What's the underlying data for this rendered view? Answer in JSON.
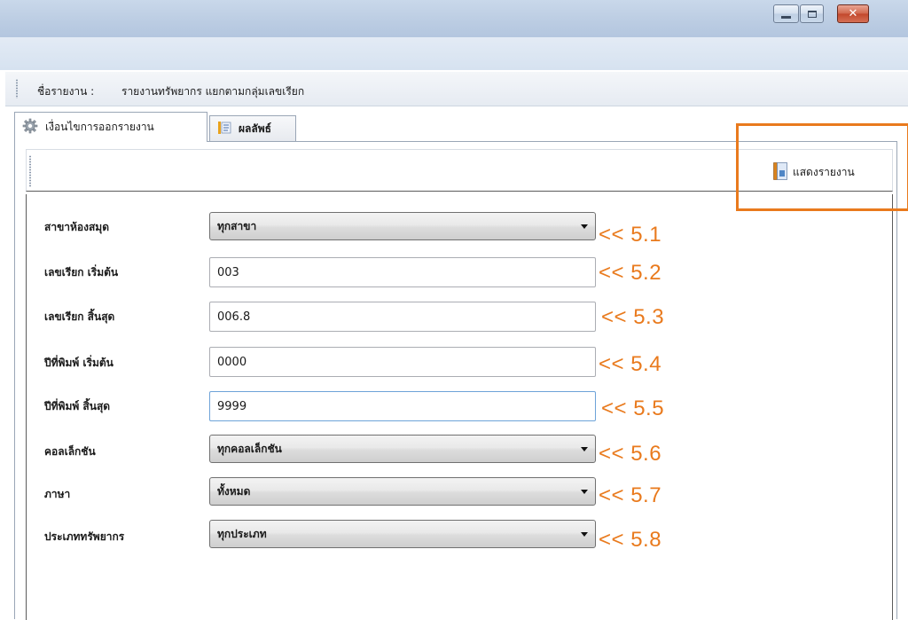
{
  "window": {
    "controls": {
      "minimize": "minimize",
      "maximize": "maximize",
      "close": "close"
    }
  },
  "report": {
    "name_label": "ชื่อรายงาน :",
    "name_value": "รายงานทรัพยากร แยกตามกลุ่มเลขเรียก"
  },
  "tabs": [
    {
      "label": "เงื่อนไขการออกรายงาน",
      "icon": "gear-icon",
      "active": true
    },
    {
      "label": "ผลลัพธ์",
      "icon": "document-list-icon",
      "active": false
    }
  ],
  "toolbar": {
    "show_report_label": "แสดงรายงาน",
    "icon": "report-book-icon"
  },
  "form": {
    "branch": {
      "label": "สาขาห้องสมุด",
      "value": "ทุกสาขา"
    },
    "callno_start": {
      "label": "เลขเรียก เริ่มต้น",
      "value": "003"
    },
    "callno_end": {
      "label": "เลขเรียก สิ้นสุด",
      "value": "006.8"
    },
    "year_start": {
      "label": "ปีที่พิมพ์ เริ่มต้น",
      "value": "0000"
    },
    "year_end": {
      "label": "ปีที่พิมพ์ สิ้นสุด",
      "value": "9999"
    },
    "collection": {
      "label": "คอลเล็กชัน",
      "value": "ทุกคอลเล็กชัน"
    },
    "language": {
      "label": "ภาษา",
      "value": "ทั้งหมด"
    },
    "resource_type": {
      "label": "ประเภททรัพยากร",
      "value": "ทุกประเภท"
    }
  },
  "annotations": [
    "<< 5.1",
    "<< 5.2",
    "<< 5.3",
    "<< 5.4",
    "<< 5.5",
    "<< 5.6",
    "<< 5.7",
    "<< 5.8"
  ],
  "colors": {
    "annotation": "#e97a1d",
    "titlebar": "#bccde3",
    "close_button": "#c2472b"
  }
}
